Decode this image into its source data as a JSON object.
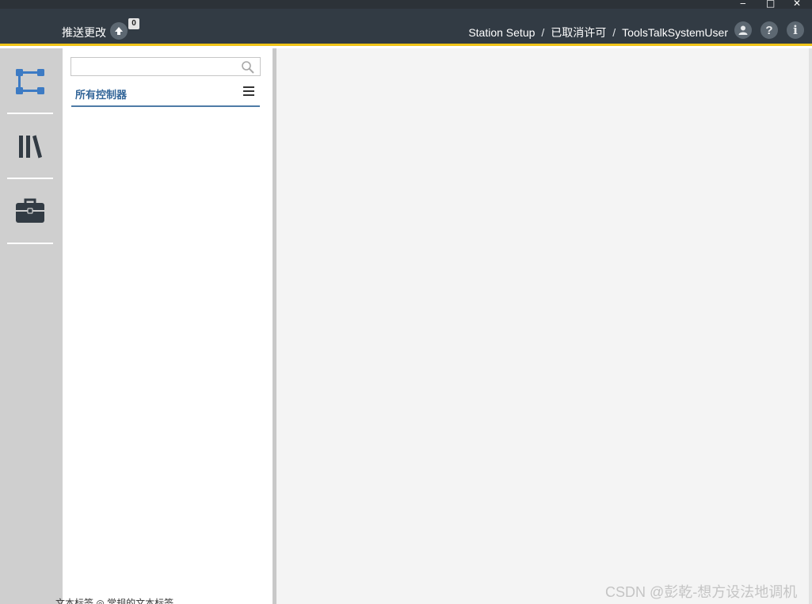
{
  "window": {
    "minimize_glyph": "‒",
    "maximize_glyph": "□",
    "close_glyph": "✕"
  },
  "topbar": {
    "push_label": "推送更改",
    "push_count": "0",
    "breadcrumb": {
      "item1": "Station Setup",
      "separator": "/",
      "item2": "已取消许可",
      "item3": "ToolsTalkSystemUser"
    },
    "help_glyph": "?",
    "info_glyph": "i",
    "accent_color": "#f0c419"
  },
  "leftnav": {
    "items": [
      {
        "icon": "controller-tree-icon"
      },
      {
        "icon": "library-icon"
      },
      {
        "icon": "toolbox-icon"
      }
    ]
  },
  "panel": {
    "search": {
      "value": "",
      "placeholder": ""
    },
    "tab_label": "所有控制器",
    "tab_color": "#336699"
  },
  "footer": {
    "hint_text": "文本标签 ◎      常规的文本标签",
    "watermark": "CSDN @彭乾-想方设法地调机"
  }
}
